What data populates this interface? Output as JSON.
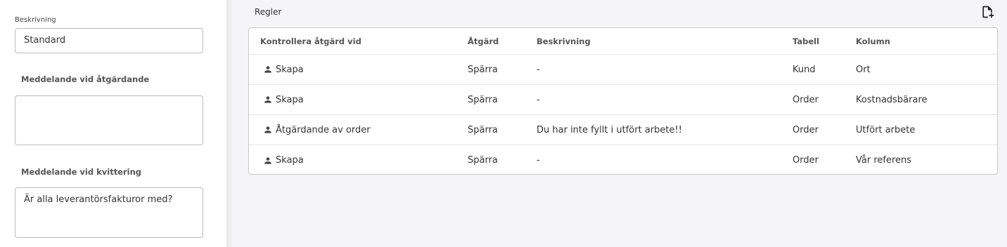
{
  "left": {
    "beskrivning_label": "Beskrivning",
    "beskrivning_value": "Standard",
    "meddelande_atgardande_label": "Meddelande vid åtgärdande",
    "meddelande_atgardande_value": "",
    "meddelande_kvittering_label": "Meddelande vid kvittering",
    "meddelande_kvittering_value": "Är alla leverantörsfakturor med?"
  },
  "rules": {
    "title": "Regler",
    "columns": [
      "Kontrollera åtgärd vid",
      "Åtgärd",
      "Beskrivning",
      "Tabell",
      "Kolumn"
    ],
    "rows": [
      {
        "trigger": "Skapa",
        "action": "Spärra",
        "description": "-",
        "table": "Kund",
        "column": "Ort"
      },
      {
        "trigger": "Skapa",
        "action": "Spärra",
        "description": "-",
        "table": "Order",
        "column": "Kostnadsbärare"
      },
      {
        "trigger": "Åtgärdande av order",
        "action": "Spärra",
        "description": "Du har inte fyllt i utfört arbete!!",
        "table": "Order",
        "column": "Utfört arbete"
      },
      {
        "trigger": "Skapa",
        "action": "Spärra",
        "description": "-",
        "table": "Order",
        "column": "Vår referens"
      }
    ],
    "row_icon": "person-icon",
    "add_icon": "add-file-icon"
  }
}
